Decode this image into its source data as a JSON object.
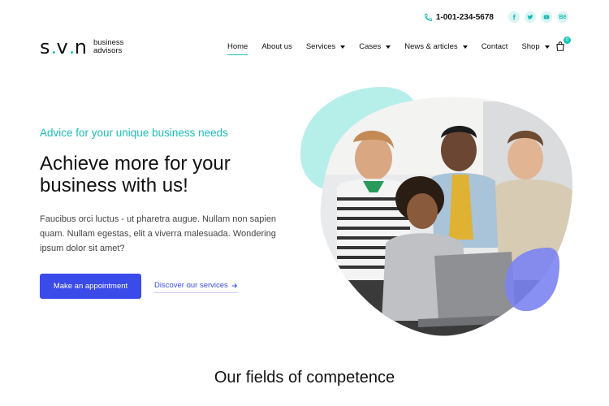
{
  "header": {
    "phone": "1-001-234-5678",
    "social": [
      {
        "name": "facebook-icon"
      },
      {
        "name": "twitter-icon"
      },
      {
        "name": "youtube-icon"
      },
      {
        "name": "behance-icon",
        "label": "Bē"
      }
    ],
    "logo": {
      "mark": "svn",
      "line1": "business",
      "line2": "advisors"
    },
    "nav": [
      {
        "label": "Home",
        "active": true
      },
      {
        "label": "About us"
      },
      {
        "label": "Services",
        "dropdown": true
      },
      {
        "label": "Cases",
        "dropdown": true
      },
      {
        "label": "News & articles",
        "dropdown": true
      },
      {
        "label": "Contact"
      },
      {
        "label": "Shop",
        "dropdown": true
      }
    ],
    "cart_count": "0"
  },
  "hero": {
    "tagline": "Advice for your unique business needs",
    "headline": "Achieve more for your business with us!",
    "paragraph": "Faucibus orci luctus - ut pharetra augue. Nullam non sapien quam. Nullam egestas, elit a viverra malesuada. Wondering ipsum dolor sit amet?",
    "primary_button": "Make an appointment",
    "secondary_link": "Discover our services"
  },
  "section": {
    "title": "Our fields of competence"
  },
  "colors": {
    "accent": "#18c1b8",
    "primary": "#3b4bea",
    "blob_teal": "#b6eeea",
    "blob_blue": "#7b84f2"
  }
}
